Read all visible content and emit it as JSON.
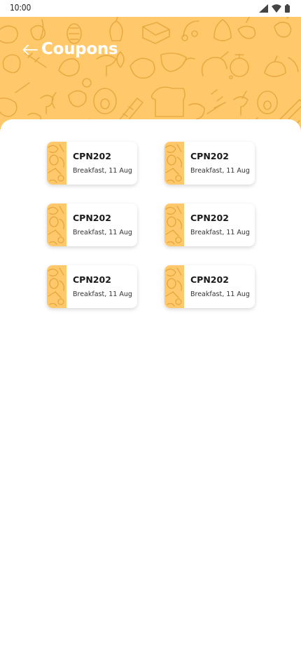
{
  "status_bar": {
    "time": "10:00",
    "icons": [
      "signal-icon",
      "wifi-icon",
      "battery-icon"
    ]
  },
  "header": {
    "title": "Coupons",
    "back_icon": "arrow-left-icon",
    "background_color": "#ffc96b",
    "pattern": "food-doodle-pattern"
  },
  "coupons": [
    {
      "code": "CPN202",
      "description": "Breakfast, 11 Aug"
    },
    {
      "code": "CPN202",
      "description": "Breakfast, 11 Aug"
    },
    {
      "code": "CPN202",
      "description": "Breakfast, 11 Aug"
    },
    {
      "code": "CPN202",
      "description": "Breakfast, 11 Aug"
    },
    {
      "code": "CPN202",
      "description": "Breakfast, 11 Aug"
    },
    {
      "code": "CPN202",
      "description": "Breakfast, 11 Aug"
    }
  ],
  "colors": {
    "accent": "#ffc96b",
    "pattern_stroke": "#e5a63e",
    "card_bg": "#ffffff"
  }
}
